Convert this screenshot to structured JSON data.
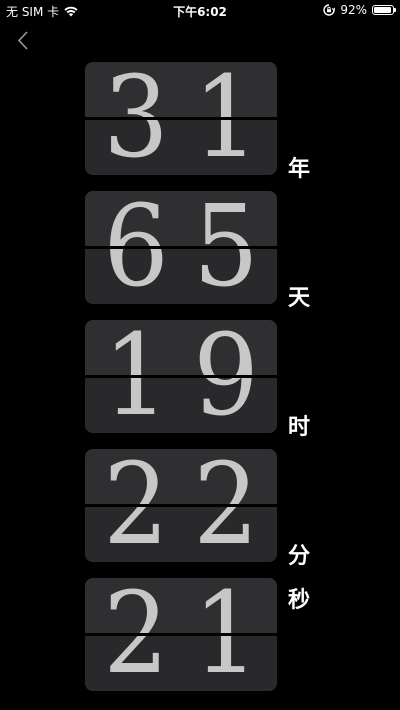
{
  "status_bar": {
    "carrier": "无 SIM 卡",
    "time": "下午6:02",
    "battery_percent": "92%",
    "battery_level": 0.92
  },
  "counter": {
    "years": {
      "digit1": "3",
      "digit2": "1",
      "unit": "年"
    },
    "days": {
      "digit1": "6",
      "digit2": "5",
      "unit": "天"
    },
    "hours": {
      "digit1": "1",
      "digit2": "9",
      "unit": "时"
    },
    "minutes": {
      "digit1": "2",
      "digit2": "2",
      "unit": "分"
    },
    "seconds": {
      "digit1": "2",
      "digit2": "1",
      "unit": "秒"
    }
  },
  "colors": {
    "background": "#000000",
    "card": "#2c2c2e",
    "digit": "#c7c7c7",
    "text": "#ffffff"
  },
  "icons": {
    "back": "chevron-left-icon",
    "wifi": "wifi-icon",
    "rotation_lock": "rotation-lock-icon",
    "battery": "battery-icon"
  }
}
